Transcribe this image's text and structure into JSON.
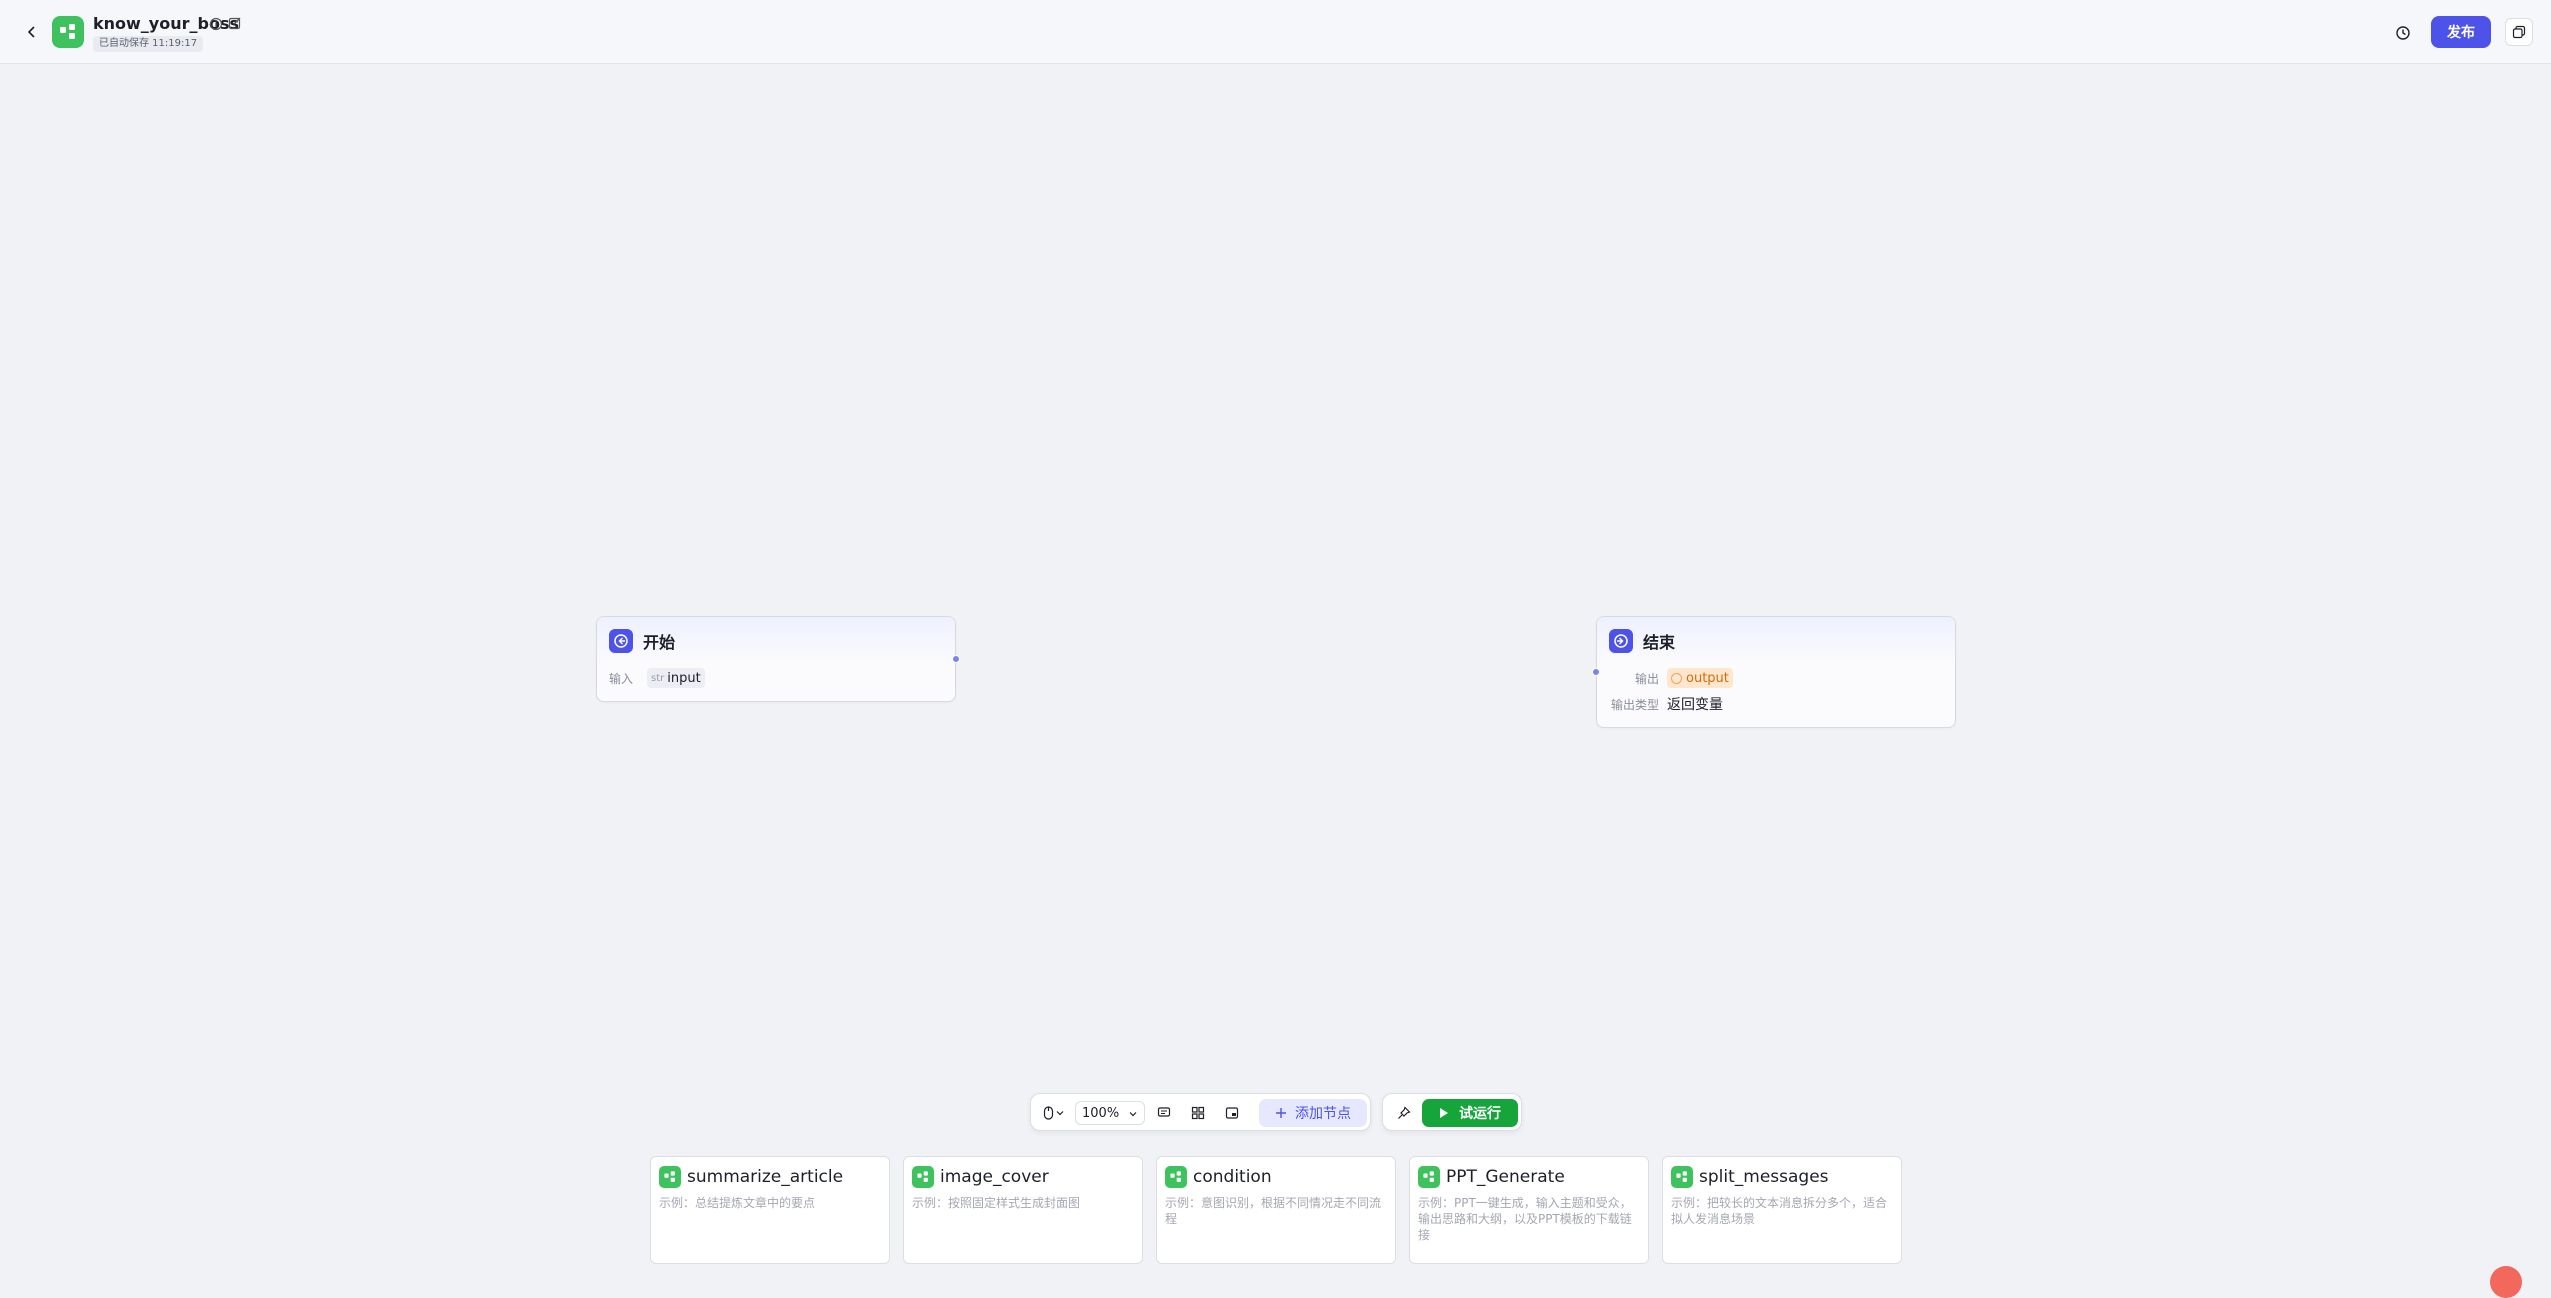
{
  "header": {
    "app_title": "know_your_boss",
    "save_status": "已自动保存 11:19:17",
    "publish_label": "发布"
  },
  "nodes": {
    "start": {
      "title": "开始",
      "input_label": "输入",
      "input_type": "str",
      "input_var": "input"
    },
    "end": {
      "title": "结束",
      "output_label": "输出",
      "output_var": "output",
      "output_type_label": "输出类型",
      "output_type_value": "返回变量"
    }
  },
  "toolbar": {
    "zoom": "100%",
    "add_node_label": "添加节点",
    "run_label": "试运行"
  },
  "templates": [
    {
      "title": "summarize_article",
      "desc": "示例：总结提炼文章中的要点"
    },
    {
      "title": "image_cover",
      "desc": "示例：按照固定样式生成封面图"
    },
    {
      "title": "condition",
      "desc": "示例：意图识别，根据不同情况走不同流程"
    },
    {
      "title": "PPT_Generate",
      "desc": "示例：PPT一键生成，输入主题和受众，输出思路和大纲，以及PPT模板的下载链接"
    },
    {
      "title": "split_messages",
      "desc": "示例：把较长的文本消息拆分多个，适合拟人发消息场景"
    }
  ],
  "colors": {
    "accent": "#4d53e8",
    "run_green": "#15a53b",
    "app_icon_green": "#3ec25e"
  },
  "icons": [
    "chevron-left-icon",
    "workflow-icon",
    "info-icon",
    "edit-icon",
    "history-icon",
    "copy-icon",
    "start-node-icon",
    "end-node-icon",
    "mouse-icon",
    "chevron-down-icon",
    "comment-icon",
    "layout-icon",
    "minimap-icon",
    "plus-icon",
    "pin-icon",
    "play-icon"
  ]
}
